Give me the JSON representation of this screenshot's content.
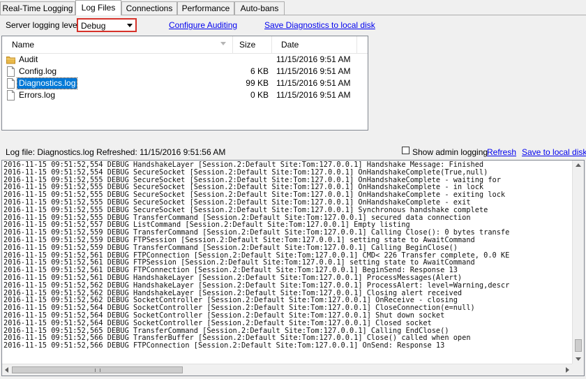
{
  "tabs": [
    {
      "label": "Real-Time Logging",
      "active": false
    },
    {
      "label": "Log Files",
      "active": true
    },
    {
      "label": "Connections",
      "active": false
    },
    {
      "label": "Performance",
      "active": false
    },
    {
      "label": "Auto-bans",
      "active": false
    }
  ],
  "logging": {
    "label": "Server logging level",
    "selected": "Debug",
    "configure_link": "Configure Auditing",
    "save_diag_link": "Save Diagnostics to local disk"
  },
  "filelist": {
    "columns": {
      "name": "Name",
      "size": "Size",
      "date": "Date"
    },
    "rows": [
      {
        "name": "Audit",
        "size": "",
        "date": "11/15/2016 9:51 AM",
        "icon": "folder-icon",
        "selected": false
      },
      {
        "name": "Config.log",
        "size": "6 KB",
        "date": "11/15/2016 9:51 AM",
        "icon": "file-icon",
        "selected": false
      },
      {
        "name": "Diagnostics.log",
        "size": "99 KB",
        "date": "11/15/2016 9:51 AM",
        "icon": "file-icon",
        "selected": true
      },
      {
        "name": "Errors.log",
        "size": "0 KB",
        "date": "11/15/2016 9:51 AM",
        "icon": "file-icon",
        "selected": false
      }
    ]
  },
  "loginfo": {
    "file_text": "Log file: Diagnostics.log  Refreshed: 11/15/2016 9:51:56 AM",
    "show_admin_label": "Show admin logging",
    "show_admin_checked": false,
    "refresh_link": "Refresh",
    "save_local_link": "Save to local disk"
  },
  "log_lines": [
    "2016-11-15 09:51:52,554 DEBUG HandshakeLayer [Session.2:Default Site:Tom:127.0.0.1] Handshake Message: Finished",
    "2016-11-15 09:51:52,554 DEBUG SecureSocket [Session.2:Default Site:Tom:127.0.0.1] OnHandshakeComplete(True,null)",
    "2016-11-15 09:51:52,555 DEBUG SecureSocket [Session.2:Default Site:Tom:127.0.0.1] OnHandshakeComplete - waiting for",
    "2016-11-15 09:51:52,555 DEBUG SecureSocket [Session.2:Default Site:Tom:127.0.0.1] OnHandshakeComplete - in lock",
    "2016-11-15 09:51:52,555 DEBUG SecureSocket [Session.2:Default Site:Tom:127.0.0.1] OnHandshakeComplete - exiting lock",
    "2016-11-15 09:51:52,555 DEBUG SecureSocket [Session.2:Default Site:Tom:127.0.0.1] OnHandshakeComplete - exit",
    "2016-11-15 09:51:52,555 DEBUG SecureSocket [Session.2:Default Site:Tom:127.0.0.1] Synchronous handshake complete",
    "2016-11-15 09:51:52,555 DEBUG TransferCommand [Session.2:Default Site:Tom:127.0.0.1] secured data connection",
    "2016-11-15 09:51:52,557 DEBUG ListCommand [Session.2:Default Site:Tom:127.0.0.1] Empty listing",
    "2016-11-15 09:51:52,559 DEBUG TransferCommand [Session.2:Default Site:Tom:127.0.0.1] Calling Close(): 0 bytes transfe",
    "2016-11-15 09:51:52,559 DEBUG FTPSession [Session.2:Default Site:Tom:127.0.0.1] setting state to AwaitCommand",
    "2016-11-15 09:51:52,559 DEBUG TransferCommand [Session.2:Default Site:Tom:127.0.0.1] Calling BeginClose()",
    "2016-11-15 09:51:52,561 DEBUG FTPConnection [Session.2:Default Site:Tom:127.0.0.1] CMD< 226 Transfer complete, 0.0 KE",
    "2016-11-15 09:51:52,561 DEBUG FTPSession [Session.2:Default Site:Tom:127.0.0.1] setting state to AwaitCommand",
    "2016-11-15 09:51:52,561 DEBUG FTPConnection [Session.2:Default Site:Tom:127.0.0.1] BeginSend: Response 13",
    "2016-11-15 09:51:52,561 DEBUG HandshakeLayer [Session.2:Default Site:Tom:127.0.0.1] ProcessMessages(Alert)",
    "2016-11-15 09:51:52,562 DEBUG HandshakeLayer [Session.2:Default Site:Tom:127.0.0.1] ProcessAlert: level=Warning,descr",
    "2016-11-15 09:51:52,562 DEBUG HandshakeLayer [Session.2:Default Site:Tom:127.0.0.1] Closing alert received",
    "2016-11-15 09:51:52,562 DEBUG SocketController [Session.2:Default Site:Tom:127.0.0.1] OnReceive - closing",
    "2016-11-15 09:51:52,564 DEBUG SocketController [Session.2:Default Site:Tom:127.0.0.1] CloseConnection(e=null)",
    "2016-11-15 09:51:52,564 DEBUG SocketController [Session.2:Default Site:Tom:127.0.0.1] Shut down socket",
    "2016-11-15 09:51:52,564 DEBUG SocketController [Session.2:Default Site:Tom:127.0.0.1] Closed socket",
    "2016-11-15 09:51:52,565 DEBUG TransferCommand [Session.2:Default Site:Tom:127.0.0.1] Calling EndClose()",
    "2016-11-15 09:51:52,566 DEBUG TransferBuffer [Session.2:Default Site:Tom:127.0.0.1] Close() called when open",
    "2016-11-15 09:51:52,566 DEBUG FTPConnection [Session.2:Default Site:Tom:127.0.0.1] OnSend: Response 13"
  ],
  "colors": {
    "accent": "#0078d7",
    "link": "#0000ee",
    "highlight_border": "#d6322a"
  }
}
